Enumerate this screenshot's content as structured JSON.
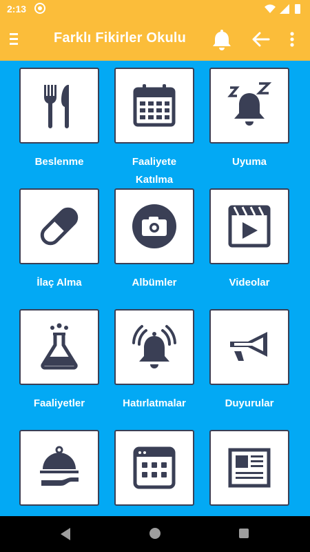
{
  "status_bar": {
    "time": "2:13"
  },
  "app_bar": {
    "title": "Farklı Fikirler Okulu"
  },
  "tiles": [
    {
      "label": "Beslenme",
      "icon": "utensils-icon"
    },
    {
      "label": "Faaliyete Katılma",
      "icon": "calendar-icon"
    },
    {
      "label": "Uyuma",
      "icon": "sleep-bell-icon"
    },
    {
      "label": "İlaç Alma",
      "icon": "pill-icon"
    },
    {
      "label": "Albümler",
      "icon": "camera-icon"
    },
    {
      "label": "Videolar",
      "icon": "video-icon"
    },
    {
      "label": "Faaliyetler",
      "icon": "flask-icon"
    },
    {
      "label": "Hatırlatmalar",
      "icon": "ringing-bell-icon"
    },
    {
      "label": "Duyurular",
      "icon": "megaphone-icon"
    },
    {
      "label": "",
      "icon": "food-tray-icon"
    },
    {
      "label": "",
      "icon": "calendar-grid-icon"
    },
    {
      "label": "",
      "icon": "newspaper-icon"
    }
  ],
  "colors": {
    "accent": "#fbbd3a",
    "background": "#03a9f4",
    "icon": "#3a3f55"
  }
}
